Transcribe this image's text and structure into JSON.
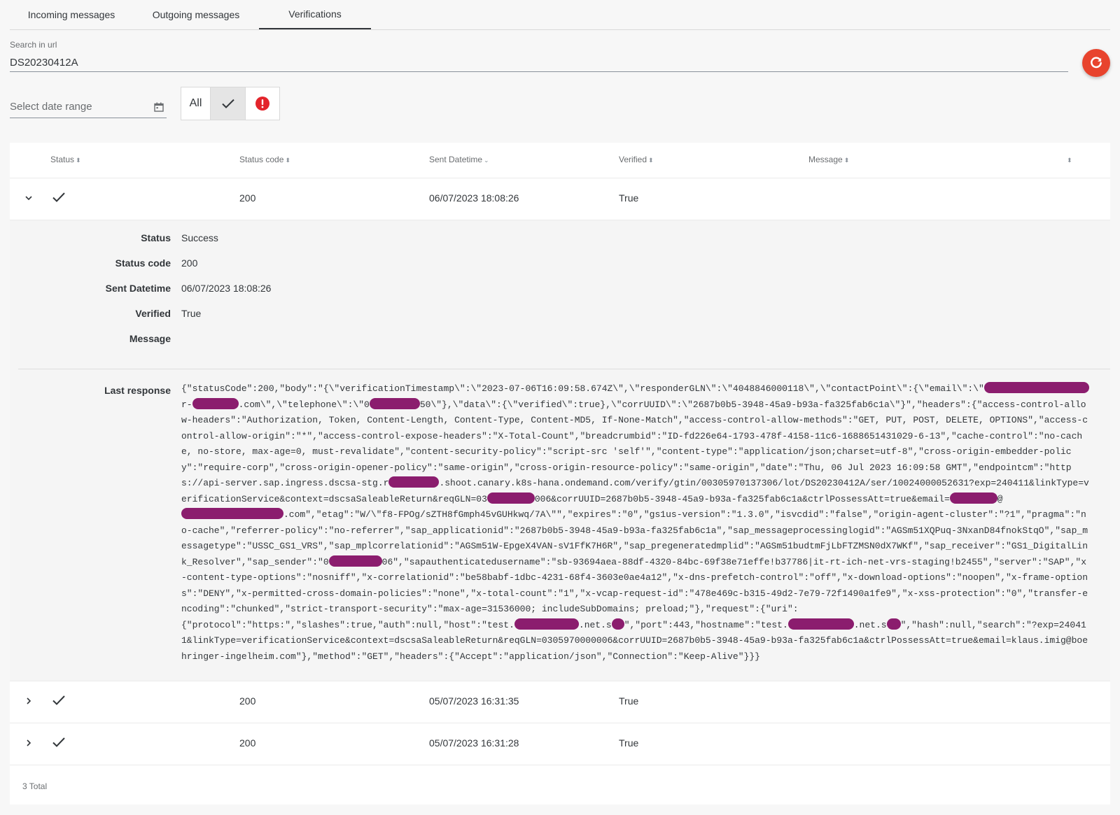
{
  "tabs": [
    {
      "label": "Incoming messages"
    },
    {
      "label": "Outgoing messages"
    },
    {
      "label": "Verifications",
      "active": true
    }
  ],
  "search": {
    "label": "Search in url",
    "value": "DS20230412A"
  },
  "date_range": {
    "placeholder": "Select date range"
  },
  "filter": {
    "all_label": "All",
    "selected": "success"
  },
  "colors": {
    "accent": "#e8432d",
    "error": "#e3242b",
    "redaction": "#8b1d6e"
  },
  "table": {
    "columns": [
      {
        "label": "Status",
        "sort": "⬍"
      },
      {
        "label": "Status code",
        "sort": "⬍"
      },
      {
        "label": "Sent Datetime",
        "sort": "⌄"
      },
      {
        "label": "Verified",
        "sort": "⬍"
      },
      {
        "label": "Message",
        "sort": "⬍"
      },
      {
        "label": "",
        "sort": "⬍"
      }
    ],
    "rows": [
      {
        "status_icon": "check-icon",
        "status_code": "200",
        "sent_datetime": "06/07/2023 18:08:26",
        "verified": "True",
        "expanded": true
      },
      {
        "status_icon": "check-icon",
        "status_code": "200",
        "sent_datetime": "05/07/2023 16:31:35",
        "verified": "True",
        "expanded": false
      },
      {
        "status_icon": "check-icon",
        "status_code": "200",
        "sent_datetime": "05/07/2023 16:31:28",
        "verified": "True",
        "expanded": false
      }
    ],
    "total": "3 Total"
  },
  "details": {
    "status_label": "Status",
    "status_value": "Success",
    "code_label": "Status code",
    "code_value": "200",
    "datetime_label": "Sent Datetime",
    "datetime_value": "06/07/2023 18:08:26",
    "verified_label": "Verified",
    "verified_value": "True",
    "message_label": "Message",
    "message_value": "",
    "last_response_label": "Last response",
    "last_response": {
      "p1": "{\"statusCode\":200,\"body\":\"{\\\"verificationTimestamp\\\":\\\"2023-07-06T16:09:58.674Z\\\",\\\"responderGLN\\\":\\\"4048846000118\\\",\\\"contactPoint\\\":{\\\"email\\\":\\\"",
      "p2": "r-",
      "p3": ".com\\\",\\\"telephone\\\":\\\"0",
      "p4": "50\\\"},\\\"data\\\":{\\\"verified\\\":true},\\\"corrUUID\\\":\\\"2687b0b5-3948-45a9-b93a-fa325fab6c1a\\\"}\",\"headers\":{\"access-control-allow-headers\":\"Authorization, Token, Content-Length, Content-Type, Content-MD5, If-None-Match\",\"access-control-allow-methods\":\"GET, PUT, POST, DELETE, OPTIONS\",\"access-control-allow-origin\":\"*\",\"access-control-expose-headers\":\"X-Total-Count\",\"breadcrumbid\":\"ID-fd226e64-1793-478f-4158-11c6-1688651431029-6-13\",\"cache-control\":\"no-cache, no-store, max-age=0, must-revalidate\",\"content-security-policy\":\"script-src 'self'\",\"content-type\":\"application/json;charset=utf-8\",\"cross-origin-embedder-policy\":\"require-corp\",\"cross-origin-opener-policy\":\"same-origin\",\"cross-origin-resource-policy\":\"same-origin\",\"date\":\"Thu, 06 Jul 2023 16:09:58 GMT\",\"endpointcm\":\"https://api-server.sap.ingress.dscsa-stg.r",
      "p5": ".shoot.canary.k8s-hana.ondemand.com/verify/gtin/00305970137306/lot/DS20230412A/ser/10024000052631?exp=240411&linkType=verificationService&context=dscsaSaleableReturn&reqGLN=03",
      "p6": "006&corrUUID=2687b0b5-3948-45a9-b93a-fa325fab6c1a&ctrlPossessAtt=true&email=",
      "p7": "@",
      "p8": ".com\",\"etag\":\"W/\\\"f8-FPOg/sZTH8fGmph45vGUHkwq/7A\\\"\",\"expires\":\"0\",\"gs1us-version\":\"1.3.0\",\"isvcdid\":\"false\",\"origin-agent-cluster\":\"?1\",\"pragma\":\"no-cache\",\"referrer-policy\":\"no-referrer\",\"sap_applicationid\":\"2687b0b5-3948-45a9-b93a-fa325fab6c1a\",\"sap_messageprocessinglogid\":\"AGSm51XQPuq-3NxanD84fnokStqO\",\"sap_messagetype\":\"USSC_GS1_VRS\",\"sap_mplcorrelationid\":\"AGSm51W-EpgeX4VAN-sV1FfK7H6R\",\"sap_pregeneratedmplid\":\"AGSm51budtmFjLbFTZMSN0dX7WKf\",\"sap_receiver\":\"GS1_DigitalLink_Resolver\",\"sap_sender\":\"0",
      "p9": "06\",\"sapauthenticatedusername\":\"sb-93694aea-88df-4320-84bc-69f38e71effe!b37786|it-rt-ich-net-vrs-staging!b2455\",\"server\":\"SAP\",\"x-content-type-options\":\"nosniff\",\"x-correlationid\":\"be58babf-1dbc-4231-68f4-3603e0ae4a12\",\"x-dns-prefetch-control\":\"off\",\"x-download-options\":\"noopen\",\"x-frame-options\":\"DENY\",\"x-permitted-cross-domain-policies\":\"none\",\"x-total-count\":\"1\",\"x-vcap-request-id\":\"478e469c-b315-49d2-7e79-72f1490a1fe9\",\"x-xss-protection\":\"0\",\"transfer-encoding\":\"chunked\",\"strict-transport-security\":\"max-age=31536000; includeSubDomains; preload;\"},\"request\":{\"uri\":\n{\"protocol\":\"https:\",\"slashes\":true,\"auth\":null,\"host\":\"test.",
      "p10": ".net.s",
      "p11": "\",\"port\":443,\"hostname\":\"test.",
      "p12": ".net.s",
      "p13": "\",\"hash\":null,\"search\":\"?exp=240411&linkType=verificationService&context=dscsaSaleableReturn&reqGLN=0305970000006&corrUUID=2687b0b5-3948-45a9-b93a-fa325fab6c1a&ctrlPossessAtt=true&email=klaus.imig@boehringer-ingelheim.com\"},\"method\":\"GET\",\"headers\":{\"Accept\":\"application/json\",\"Connection\":\"Keep-Alive\"}}}"
    }
  }
}
